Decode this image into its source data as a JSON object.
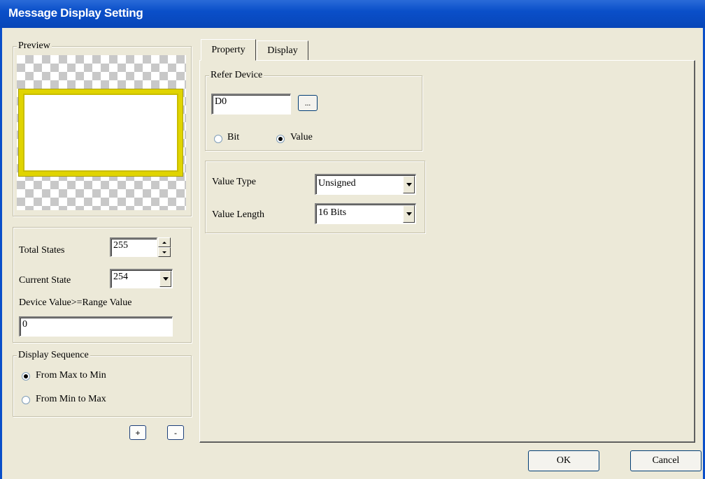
{
  "window": {
    "title": "Message Display Setting"
  },
  "preview": {
    "legend": "Preview",
    "frame_color": "#e0d400"
  },
  "states": {
    "total_label": "Total States",
    "total_value": "255",
    "current_label": "Current State",
    "current_value": "254",
    "range_label": "Device Value>=Range Value",
    "range_value": "0"
  },
  "sequence": {
    "legend": "Display Sequence",
    "options": [
      "From Max to Min",
      "From Min to Max"
    ],
    "selected": "From Max to Min"
  },
  "state_buttons": {
    "add": "+",
    "remove": "-"
  },
  "tabs": [
    {
      "label": "Property",
      "active": true
    },
    {
      "label": "Display",
      "active": false
    }
  ],
  "refer_device": {
    "legend": "Refer Device",
    "value": "D0",
    "browse": "...",
    "options": [
      "Bit",
      "Value"
    ],
    "selected": "Value"
  },
  "value_settings": {
    "type_label": "Value Type",
    "type_value": "Unsigned",
    "length_label": "Value Length",
    "length_value": "16 Bits"
  },
  "footer": {
    "ok": "OK",
    "cancel": "Cancel"
  }
}
